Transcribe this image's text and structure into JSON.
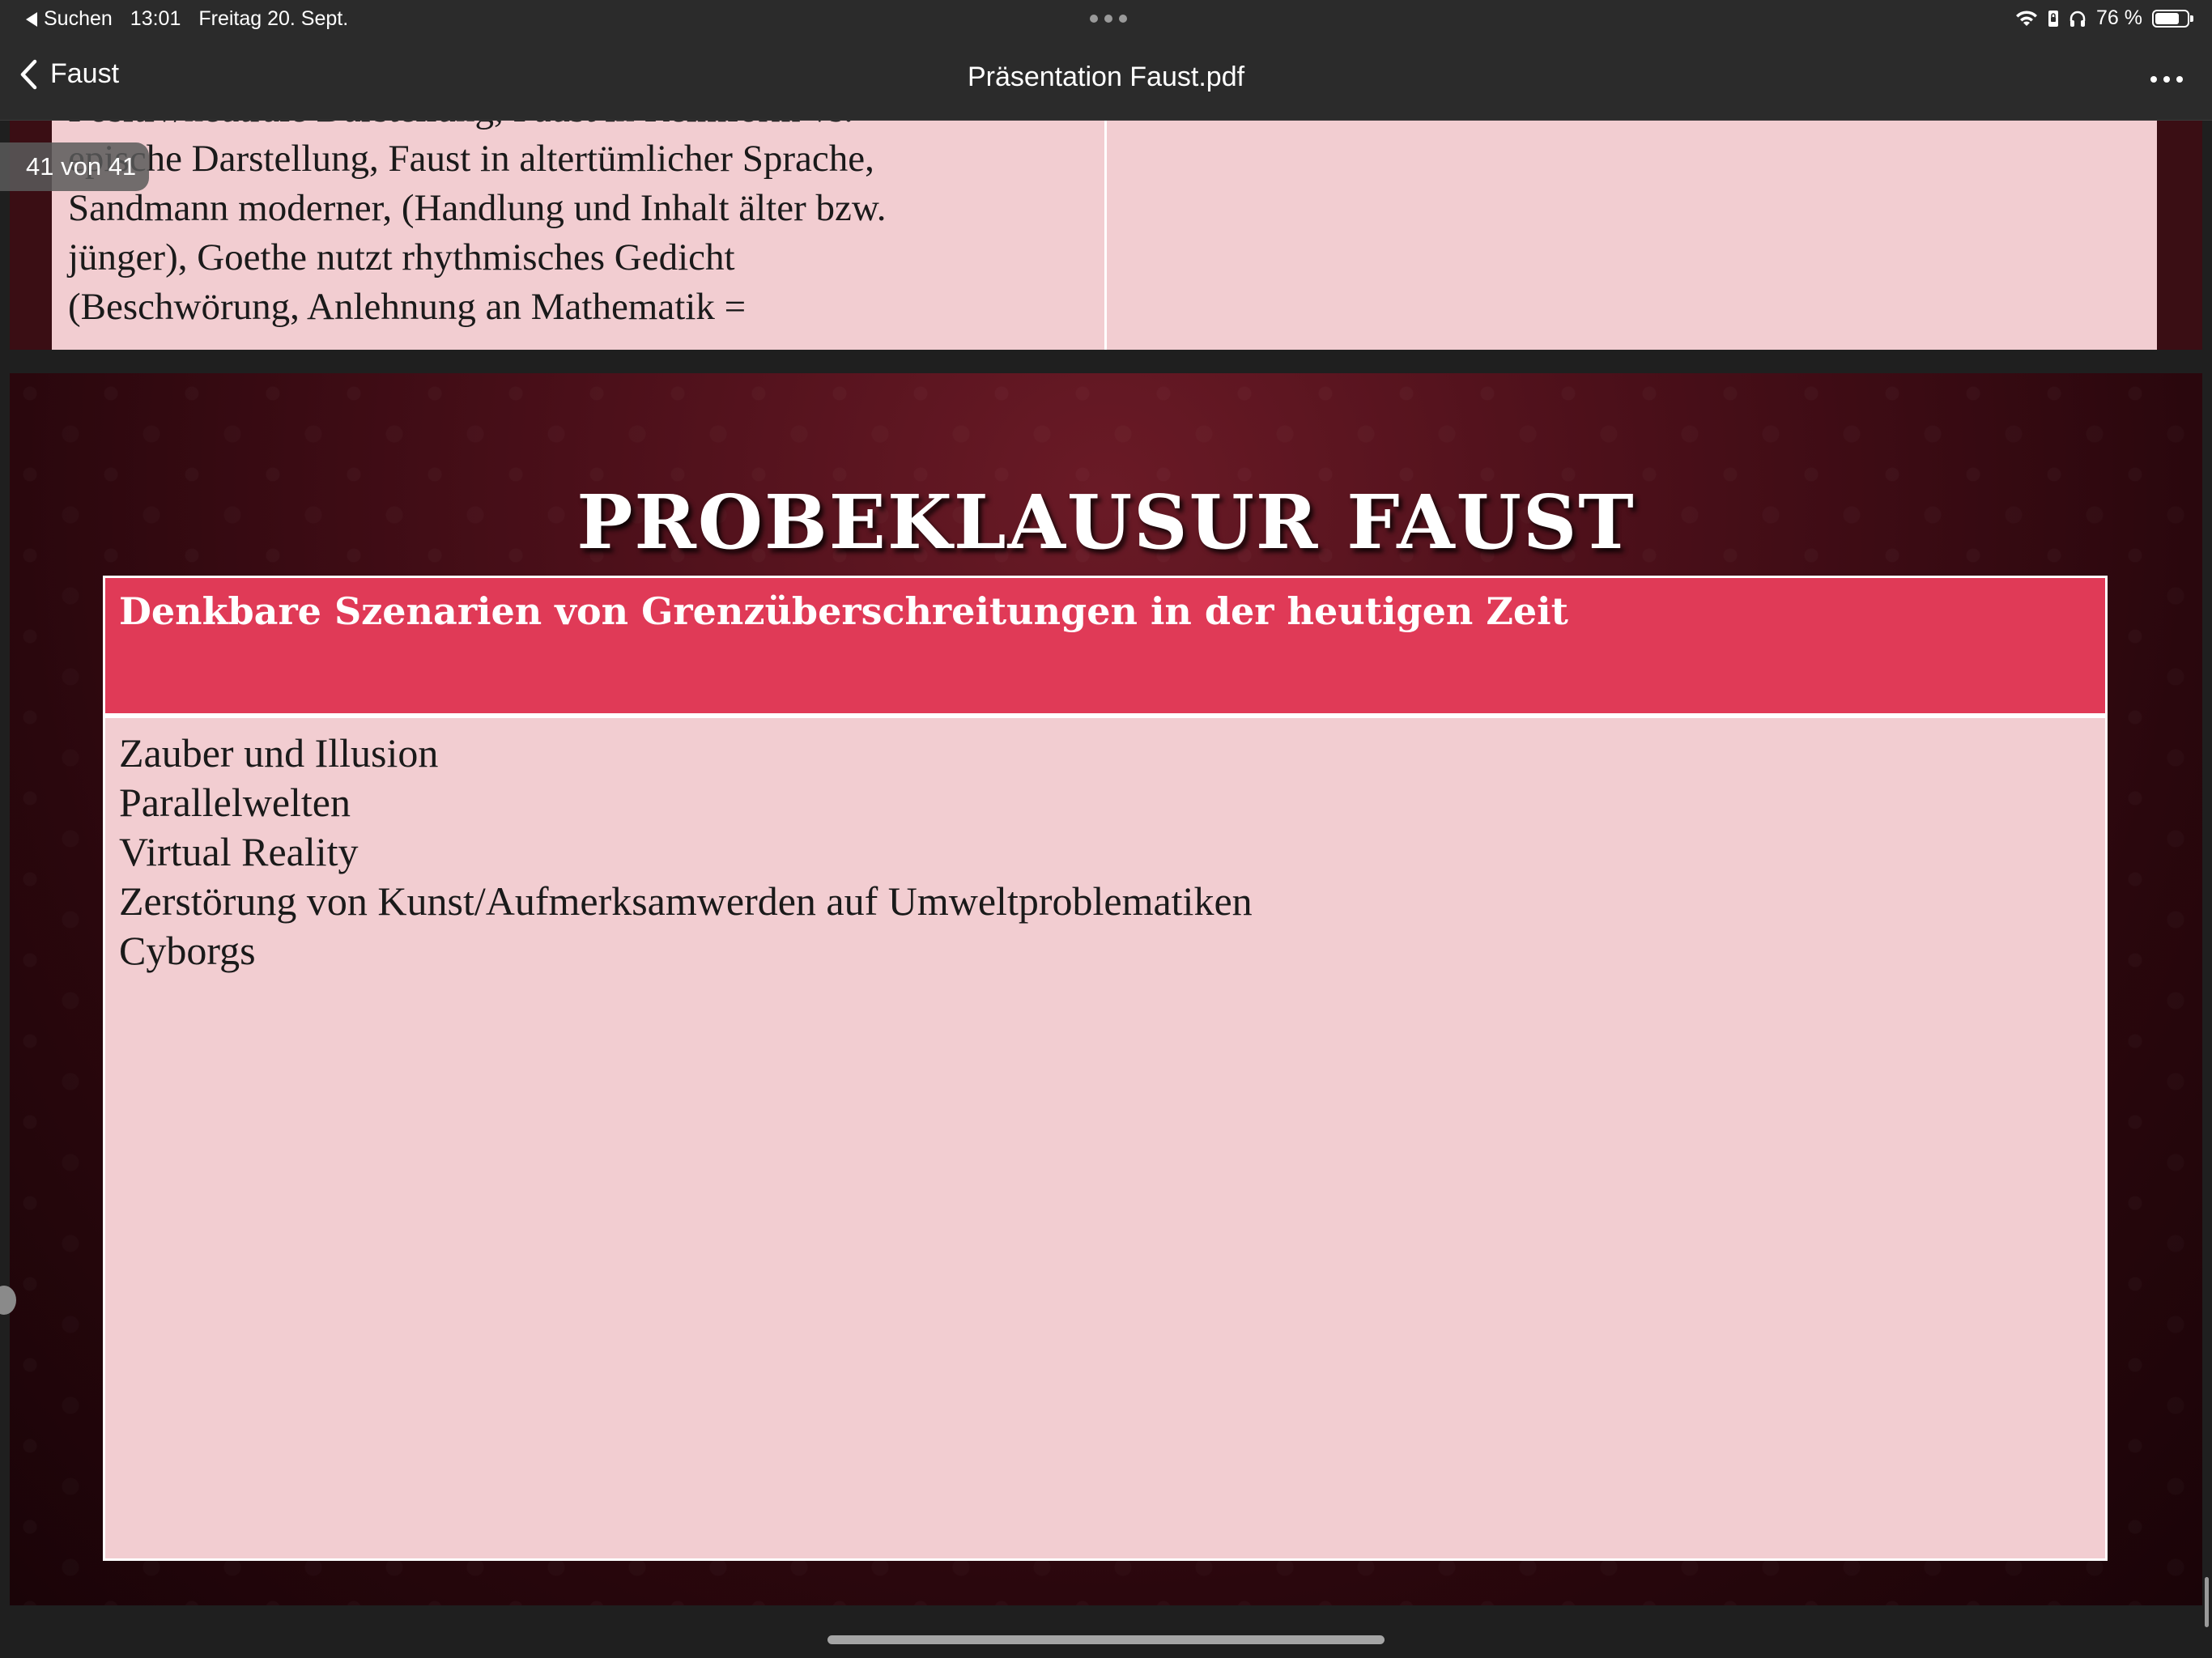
{
  "status_bar": {
    "back_app": "Suchen",
    "time": "13:01",
    "date": "Freitag 20. Sept.",
    "battery_percent": "76 %",
    "battery_level": 0.76,
    "icons": [
      "wifi-icon",
      "lock-rotation-icon",
      "headphones-icon",
      "battery-icon"
    ]
  },
  "nav": {
    "back_label": "Faust",
    "title": "Präsentation Faust.pdf",
    "more_icon": "ellipsis-icon"
  },
  "page_indicator": "41 von 41",
  "previous_page": {
    "lines": [
      "Positiv/neutrale Darstellung, Faust in Reimform vs.",
      "epische Darstellung, Faust in altertümlicher Sprache,",
      "Sandmann moderner, (Handlung und Inhalt älter bzw.",
      "jünger), Goethe nutzt rhythmisches Gedicht",
      "(Beschwörung, Anlehnung an Mathematik ="
    ]
  },
  "slide": {
    "title": "PROBEKLAUSUR FAUST",
    "table_header": "Denkbare Szenarien von Grenzüberschreitungen in der heutigen Zeit",
    "items": [
      "Zauber und Illusion",
      "Parallelwelten",
      "Virtual Reality",
      "Zerstörung von Kunst/Aufmerksamwerden auf Umweltproblematiken",
      "Cyborgs"
    ]
  },
  "colors": {
    "header_red": "#e03a57",
    "table_pink": "#f2cdd1",
    "slide_bg": "#4a0f19",
    "chrome_bg": "#2b2b2b"
  }
}
